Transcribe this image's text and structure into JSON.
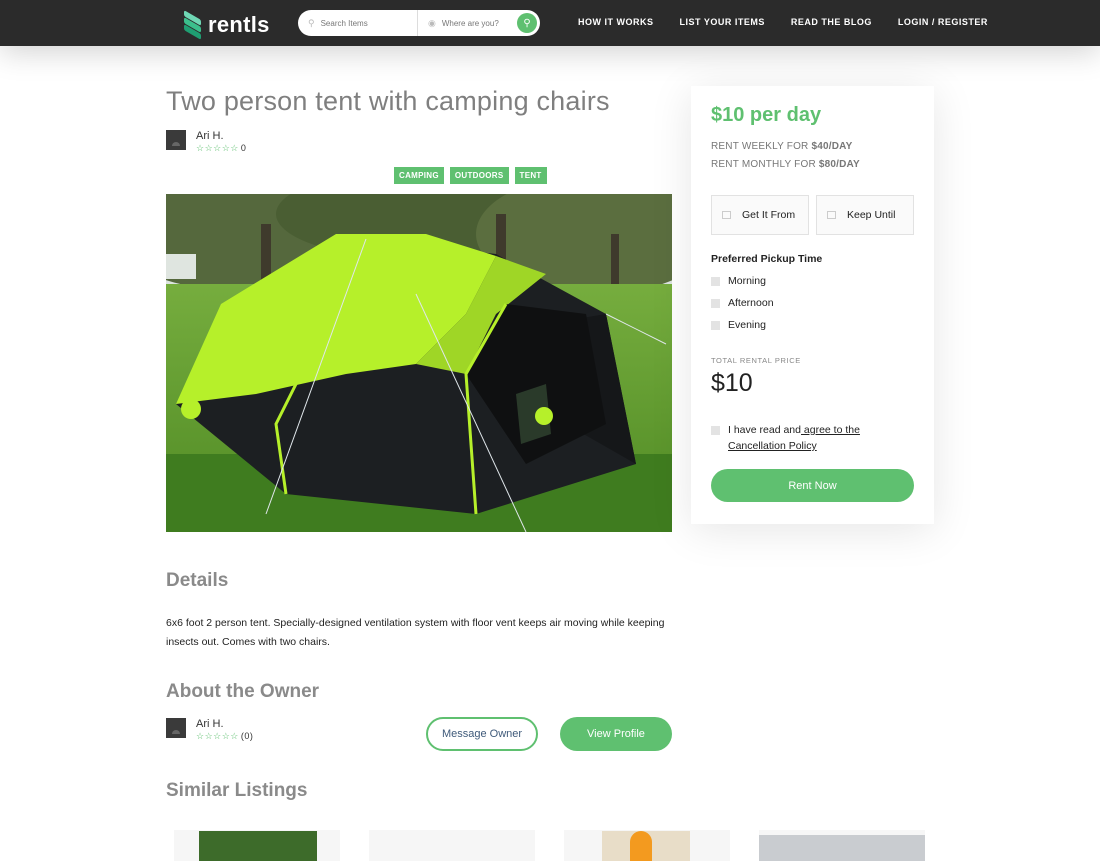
{
  "nav": {
    "brand": "rentls",
    "search_placeholder": "Search Items",
    "location_placeholder": "Where are you?",
    "links": [
      "HOW IT WORKS",
      "LIST YOUR ITEMS",
      "READ THE BLOG",
      "LOGIN / REGISTER"
    ]
  },
  "listing": {
    "title": "Two person tent with camping chairs",
    "owner_name": "Ari H.",
    "rating_count": "0",
    "tags": [
      "CAMPING",
      "OUTDOORS",
      "TENT"
    ]
  },
  "details": {
    "heading": "Details",
    "text": "6x6 foot 2 person tent. Specially-designed ventilation system with floor vent keeps air moving while keeping insects out. Comes with two chairs."
  },
  "owner_section": {
    "heading": "About the Owner",
    "owner_name": "Ari H.",
    "rating_count": "(0)",
    "message_button": "Message Owner",
    "profile_button": "View Profile"
  },
  "similar": {
    "heading": "Similar Listings"
  },
  "booking": {
    "price_per_day": "$10 per day",
    "weekly_prefix": "RENT WEEKLY FOR ",
    "weekly_price": "$40/DAY",
    "monthly_prefix": "RENT MONTHLY FOR ",
    "monthly_price": "$80/DAY",
    "get_from": "Get It From",
    "keep_until": "Keep Until",
    "pickup_heading": "Preferred Pickup Time",
    "pickup_options": [
      "Morning",
      "Afternoon",
      "Evening"
    ],
    "total_label": "TOTAL RENTAL PRICE",
    "total_value": "$10",
    "terms_prefix": "I have read and",
    "terms_link": " agree to the Cancellation Policy",
    "rent_button": "Rent Now"
  },
  "colors": {
    "accent": "#5fc070",
    "nav_bg": "#2b2b2b",
    "heading_gray": "#8a8a8a"
  }
}
